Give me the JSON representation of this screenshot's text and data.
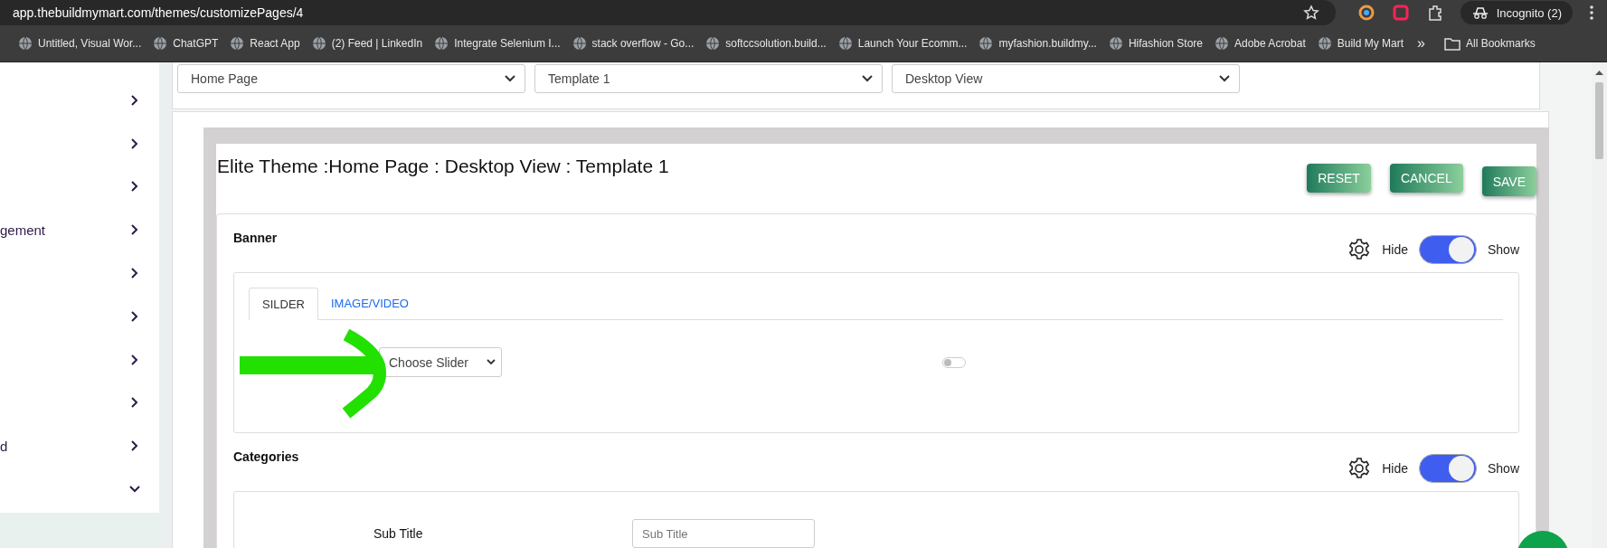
{
  "browser": {
    "url": "app.thebuildmymart.com/themes/customizePages/4",
    "profile": "Incognito (2)",
    "bookmarks": [
      {
        "label": "Untitled, Visual Wor..."
      },
      {
        "label": "ChatGPT"
      },
      {
        "label": "React App"
      },
      {
        "label": "(2) Feed | LinkedIn"
      },
      {
        "label": "Integrate Selenium I..."
      },
      {
        "label": "stack overflow - Go..."
      },
      {
        "label": "softccsolution.build..."
      },
      {
        "label": "Launch Your Ecomm..."
      },
      {
        "label": "myfashion.buildmy..."
      },
      {
        "label": "Hifashion Store"
      },
      {
        "label": "Adobe Acrobat"
      },
      {
        "label": "Build My Mart"
      }
    ],
    "more": "»",
    "all_bookmarks": "All Bookmarks"
  },
  "sidebar": {
    "items": [
      {
        "expanded": false
      },
      {
        "expanded": false
      },
      {
        "expanded": false
      },
      {
        "label": "gement",
        "expanded": false
      },
      {
        "expanded": false
      },
      {
        "expanded": false
      },
      {
        "expanded": false
      },
      {
        "expanded": false
      },
      {
        "label": "d",
        "expanded": false
      },
      {
        "expanded": true
      }
    ]
  },
  "selects": [
    {
      "value": "Home Page"
    },
    {
      "value": "Template 1"
    },
    {
      "value": "Desktop View"
    }
  ],
  "editor": {
    "title": "Elite Theme :Home Page : Desktop View : Template 1",
    "buttons": [
      {
        "label": "RESET"
      },
      {
        "label": "CANCEL"
      },
      {
        "label": "SAVE"
      }
    ],
    "sections": [
      {
        "title": "Banner",
        "kind": "tabs",
        "hide_label": "Hide",
        "show_label": "Show",
        "visible": true,
        "tabs": [
          {
            "label": "SILDER",
            "selected": true
          },
          {
            "label": "IMAGE/VIDEO",
            "selected": false
          }
        ],
        "slider_select": "Choose Slider",
        "slider_on": false
      },
      {
        "title": "Categories",
        "kind": "fields",
        "hide_label": "Hide",
        "show_label": "Show",
        "visible": true,
        "fields": [
          {
            "label": "Sub Title",
            "placeholder": "Sub Title"
          }
        ]
      }
    ]
  }
}
